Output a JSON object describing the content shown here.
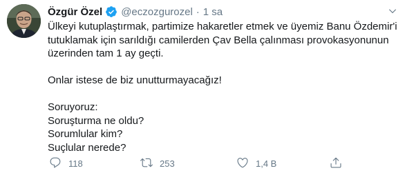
{
  "tweet": {
    "display_name": "Özgür Özel",
    "handle": "@eczozgurozel",
    "separator": "·",
    "time": "1 sa",
    "lines": [
      "Ülkeyi kutuplaştırmak, partimize hakaretler etmek ve üyemiz Banu Özdemir'i",
      "tutuklamak için sarıldığı camilerden Çav Bella çalınması provokasyonunun",
      "üzerinden tam 1 ay geçti.",
      "",
      "Onlar istese de biz unutturmayacağız!",
      "",
      "Soruyoruz:",
      "Soruşturma ne oldu?",
      "Sorumlular kim?",
      "Suçlular nerede?"
    ]
  },
  "actions": {
    "reply_count": "118",
    "retweet_count": "253",
    "like_count": "1,4 B",
    "reply_icon": "reply-icon",
    "retweet_icon": "retweet-icon",
    "like_icon": "like-icon",
    "share_icon": "share-icon"
  },
  "colors": {
    "text": "#14171a",
    "secondary": "#657786",
    "verified": "#1da1f2"
  }
}
